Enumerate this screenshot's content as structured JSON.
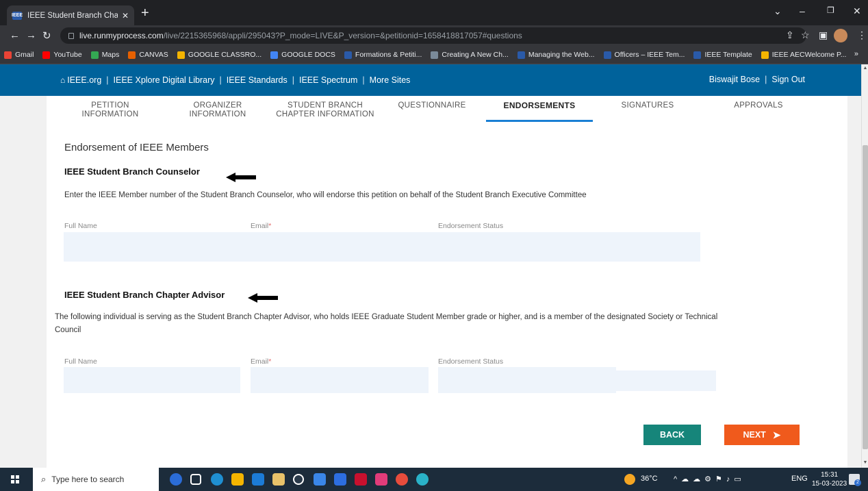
{
  "browser": {
    "tab_title": "IEEE Student Branch Chapter Vie",
    "tab_favicon": "IEEE",
    "url_host": "live.runmyprocess.com",
    "url_path": "/live/2215365968/appli/295043?P_mode=LIVE&P_version=&petitionid=1658418817057#questions",
    "bookmarks": [
      {
        "label": "Gmail",
        "color": "#ea4335"
      },
      {
        "label": "YouTube",
        "color": "#ff0000"
      },
      {
        "label": "Maps",
        "color": "#34a853"
      },
      {
        "label": "CANVAS",
        "color": "#e66000"
      },
      {
        "label": "GOOGLE CLASSRO...",
        "color": "#f4b400"
      },
      {
        "label": "GOOGLE DOCS",
        "color": "#4285f4"
      },
      {
        "label": "Formations & Petiti...",
        "color": "#2a5aa8"
      },
      {
        "label": "Creating A New Ch...",
        "color": "#7a8a99"
      },
      {
        "label": "Managing the Web...",
        "color": "#2a5aa8"
      },
      {
        "label": "Officers – IEEE Tem...",
        "color": "#2a5aa8"
      },
      {
        "label": "IEEE Template",
        "color": "#2a5aa8"
      },
      {
        "label": "IEEE AECWelcome P...",
        "color": "#f4b400"
      }
    ],
    "more": "»"
  },
  "ieee_nav": {
    "home": "IEEE.org",
    "links": [
      "IEEE Xplore Digital Library",
      "IEEE Standards",
      "IEEE Spectrum",
      "More Sites"
    ],
    "user": "Biswajit Bose",
    "sign_out": "Sign Out",
    "separator": "|"
  },
  "steps": [
    {
      "line1": "PETITION",
      "line2": "INFORMATION"
    },
    {
      "line1": "ORGANIZER",
      "line2": "INFORMATION"
    },
    {
      "line1": "STUDENT BRANCH",
      "line2": "CHAPTER INFORMATION"
    },
    {
      "line1": "QUESTIONNAIRE",
      "line2": ""
    },
    {
      "line1": "ENDORSEMENTS",
      "line2": ""
    },
    {
      "line1": "SIGNATURES",
      "line2": ""
    },
    {
      "line1": "APPROVALS",
      "line2": ""
    }
  ],
  "active_step": "ENDORSEMENTS",
  "form": {
    "section_title": "Endorsement of IEEE Members",
    "counselor": {
      "heading": "IEEE Student Branch Counselor",
      "description": "Enter the IEEE Member number of the Student Branch Counselor, who will endorse this petition on behalf of the Student Branch Executive Committee",
      "col_full_name": "Full Name",
      "col_email": "Email",
      "col_status": "Endorsement Status"
    },
    "advisor": {
      "heading": "IEEE Student Branch Chapter Advisor",
      "description_line1": "The following individual is serving as the Student Branch Chapter Advisor, who holds IEEE Graduate Student Member grade or higher, and is a member of the designated Society or Technical",
      "description_line2": "Council",
      "col_full_name": "Full Name",
      "col_email": "Email",
      "col_status": "Endorsement Status"
    },
    "required_mark": "*",
    "back_label": "BACK",
    "next_label": "NEXT"
  },
  "taskbar": {
    "search_placeholder": "Type here to search",
    "weather": "36°C",
    "language": "ENG",
    "time": "15:31",
    "date": "15-03-2023",
    "notification_count": "2"
  },
  "colors": {
    "ieee_blue": "#00629b",
    "active_underline": "#1a7fd4",
    "back_button": "#16857a",
    "next_button": "#f05a1c",
    "field_bg": "#eef4fb"
  }
}
